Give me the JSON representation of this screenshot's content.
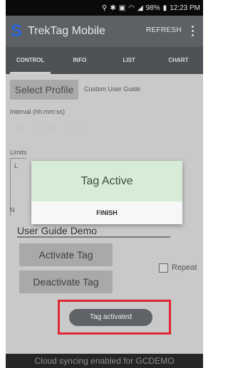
{
  "status_bar": {
    "battery": "98%",
    "time": "12:23 PM",
    "icons": [
      "location-icon",
      "bluetooth-icon",
      "nfc-icon",
      "wifi-icon",
      "signal-icon",
      "battery-icon"
    ]
  },
  "app_bar": {
    "title": "TrekTag Mobile",
    "refresh_label": "REFRESH",
    "logo_icon": "trektag-logo-icon",
    "logo_color": "#2a64d8"
  },
  "tabs": [
    {
      "label": "CONTROL",
      "active": true
    },
    {
      "label": "INFO",
      "active": false
    },
    {
      "label": "LIST",
      "active": false
    },
    {
      "label": "CHART",
      "active": false
    }
  ],
  "control": {
    "select_profile_label": "Select Profile",
    "profile_name": "Custom User Guide",
    "interval_label": "Interval (hh:mm:ss)",
    "interval_values": [
      "11",
      ":",
      "30",
      ":",
      "11"
    ],
    "limits_label": "Limits",
    "limits_letter": "L",
    "name_letter": "N",
    "name_value": "User Guide Demo",
    "activate_label": "Activate Tag",
    "deactivate_label": "Deactivate Tag",
    "repeat_label": "Repeat",
    "repeat_checked": false
  },
  "toast": {
    "text": "Tag activated",
    "highlight_color": "#e0262f"
  },
  "footer": {
    "text": "Cloud syncing enabled for GCDEMO"
  },
  "dialog": {
    "title": "Tag Active",
    "button_label": "FINISH",
    "header_color": "#d6ecd6"
  }
}
